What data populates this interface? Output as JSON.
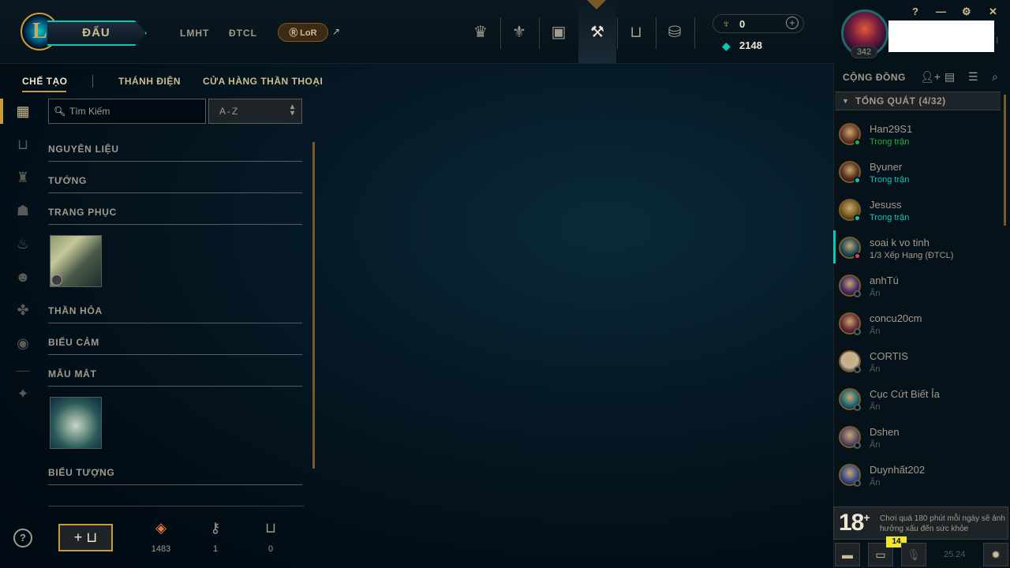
{
  "topnav": {
    "logo_letter": "L",
    "play_label": "ĐẤU",
    "links": [
      "LMHT",
      "ĐTCL"
    ],
    "lor_label": "LoR",
    "lor_arrow": "↗",
    "icons": [
      "worlds-icon",
      "clash-icon",
      "store-bag-icon",
      "crafting-icon",
      "collection-icon",
      "loot-coins-icon"
    ]
  },
  "currency": {
    "rp_value": "0",
    "rp_plus": "+",
    "be_value": "2148"
  },
  "profile": {
    "level": "342",
    "name_suffix": "I"
  },
  "window_controls": {
    "help": "?",
    "minimize": "—",
    "settings": "⚙",
    "close": "✕"
  },
  "subtabs": [
    "CHẾ TẠO",
    "THÁNH ĐIỆN",
    "CỬA HÀNG THẦN THOẠI"
  ],
  "search": {
    "placeholder": "Tìm Kiếm"
  },
  "sort": {
    "value": "A-Z"
  },
  "categories": [
    "NGUYÊN LIỆU",
    "TƯỚNG",
    "TRANG PHỤC",
    "THẦN HỎA",
    "BIỂU CẢM",
    "MẪU MẮT",
    "BIỂU TƯỢNG"
  ],
  "bottom": {
    "help": "?",
    "add_label": "+",
    "resources": [
      {
        "icon": "orange-essence-icon",
        "value": "1483"
      },
      {
        "icon": "key-icon",
        "value": "1"
      },
      {
        "icon": "chest-icon",
        "value": "0"
      }
    ]
  },
  "social": {
    "title": "CỘNG ĐỒNG",
    "group_label": "TỔNG QUÁT (4/32)",
    "friends": [
      {
        "name": "Han29S1",
        "status": "Trong trận",
        "status_color": "#1eb43c",
        "avatar": "#6b3a2a"
      },
      {
        "name": "Byuner",
        "status": "Trong trận",
        "status_color": "#0ac8b9",
        "avatar": "#5a3020"
      },
      {
        "name": "Jesuss",
        "status": "Trong trận",
        "status_color": "#0ac8b9",
        "avatar": "#7a5a20"
      },
      {
        "name": "soai k vo tinh",
        "status": "1/3 Xếp Hạng (ĐTCL)",
        "status_color": "#e84057",
        "avatar": "#1e4a5a"
      },
      {
        "name": "anhTú",
        "status": "Ẩn",
        "status_color": "#5b5a56",
        "avatar": "#4a2a6a"
      },
      {
        "name": "concu20cm",
        "status": "Ẩn",
        "status_color": "#5b5a56",
        "avatar": "#6a2a3a"
      },
      {
        "name": "CORTIS",
        "status": "Ẩn",
        "status_color": "#5b5a56",
        "avatar": "#c8b4a0"
      },
      {
        "name": "Cục Cứt Biết Ỉa",
        "status": "Ẩn",
        "status_color": "#5b5a56",
        "avatar": "#1e6a7a"
      },
      {
        "name": "Dshen",
        "status": "Ẩn",
        "status_color": "#5b5a56",
        "avatar": "#5a4a6a"
      },
      {
        "name": "Duynhất202",
        "status": "Ẩn",
        "status_color": "#5b5a56",
        "avatar": "#3a4a8a"
      }
    ],
    "age_rating": "18",
    "age_plus": "+",
    "warning": "Chơi quá 180 phút mỗi ngày sẽ ảnh hưởng xấu đến sức khỏe",
    "notif_count": "14",
    "version": "25.24"
  },
  "colors": {
    "gold": "#c89b3c",
    "teal": "#0ac8b9",
    "bg": "#010a13"
  }
}
